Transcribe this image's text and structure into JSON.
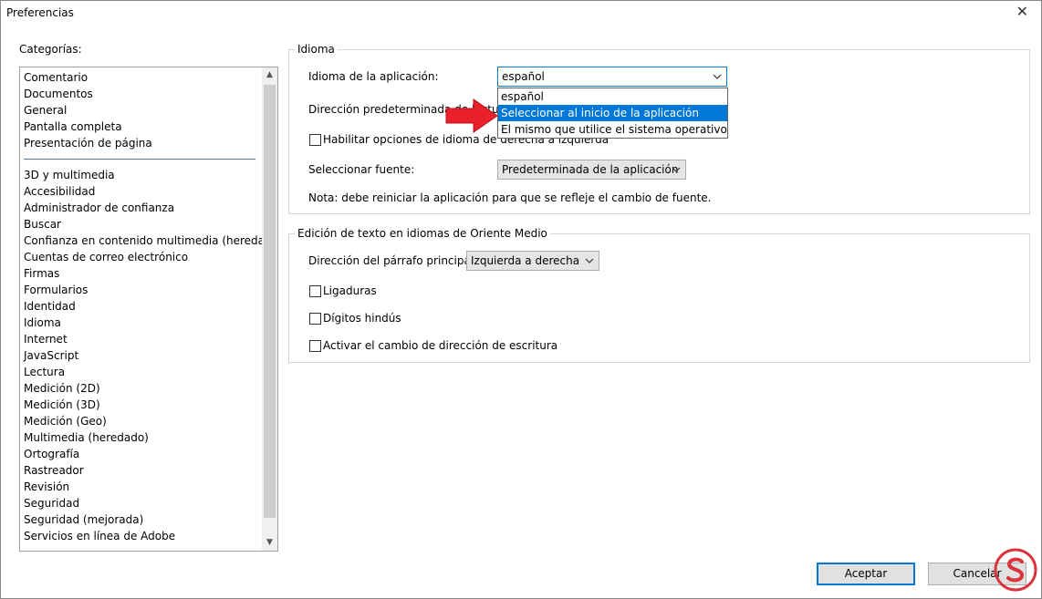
{
  "window": {
    "title": "Preferencias",
    "close_glyph": "✕"
  },
  "categories": {
    "label": "Categorías:",
    "top_items": [
      "Comentario",
      "Documentos",
      "General",
      "Pantalla completa",
      "Presentación de página"
    ],
    "items": [
      "3D y multimedia",
      "Accesibilidad",
      "Administrador de confianza",
      "Buscar",
      "Confianza en contenido multimedia (heredado)",
      "Cuentas de correo electrónico",
      "Firmas",
      "Formularios",
      "Identidad",
      "Idioma",
      "Internet",
      "JavaScript",
      "Lectura",
      "Medición (2D)",
      "Medición (3D)",
      "Medición (Geo)",
      "Multimedia (heredado)",
      "Ortografía",
      "Rastreador",
      "Revisión",
      "Seguridad",
      "Seguridad (mejorada)",
      "Servicios en línea de Adobe"
    ],
    "scroll_up_glyph": "▲",
    "scroll_down_glyph": "▼"
  },
  "idioma": {
    "legend": "Idioma",
    "app_language_label": "Idioma de la aplicación:",
    "app_language_value": "español",
    "dropdown_options": [
      "español",
      "Seleccionar al inicio de la aplicación",
      "El mismo que utilice el sistema operativo"
    ],
    "dropdown_highlighted": "Seleccionar al inicio de la aplicación",
    "reading_direction_label": "Dirección predeterminada de lectura:",
    "rtl_checkbox_label": "Habilitar opciones de idioma de derecha a izquierda",
    "font_label": "Seleccionar fuente:",
    "font_value": "Predeterminada de la aplicación",
    "note": "Nota: debe reiniciar la aplicación para que se refleje el cambio de fuente."
  },
  "middle_east": {
    "legend": "Edición de texto en idiomas de Oriente Medio",
    "paragraph_direction_label": "Dirección del párrafo principal:",
    "paragraph_direction_value": "Izquierda a derecha",
    "ligatures_label": "Ligaduras",
    "hindi_digits_label": "Dígitos hindús",
    "writing_direction_label": "Activar el cambio de dirección de escritura"
  },
  "buttons": {
    "accept": "Aceptar",
    "cancel": "Cancelar"
  },
  "colors": {
    "accent": "#0078d7",
    "annotation_arrow": "#e8212a",
    "watermark": "#d9343a"
  },
  "icons": {
    "dropdown_arrow": "chevron-down-icon",
    "annotation": "red-arrow-icon",
    "watermark": "solvetic-logo"
  }
}
